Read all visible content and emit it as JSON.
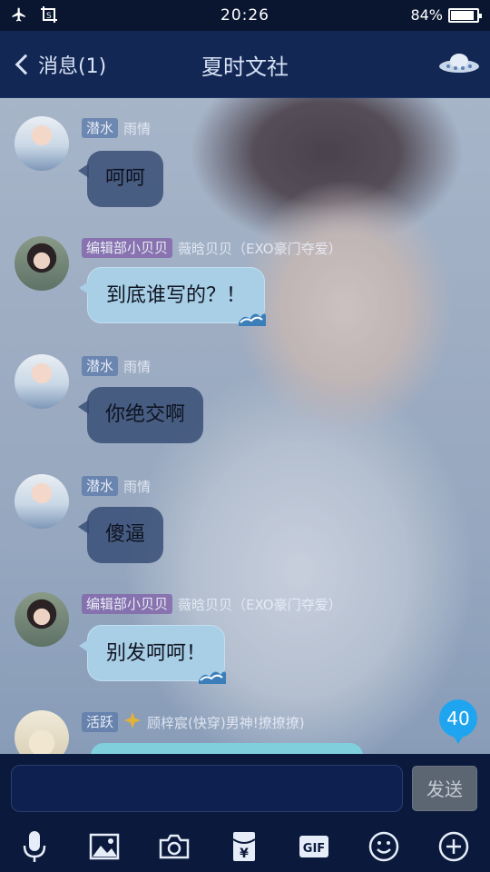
{
  "status_bar": {
    "left_icons": [
      "airplane-icon",
      "screenshot-icon"
    ],
    "time": "20:26",
    "battery_text": "84%",
    "battery_level": 0.84
  },
  "header": {
    "back_label": "消息(1)",
    "title": "夏时文社",
    "right_icon": "ufo-icon"
  },
  "messages": [
    {
      "badge": "潜水",
      "badge_color": "blue",
      "sender": "雨情",
      "text": "呵呵",
      "bubble": "dark",
      "avatar": "a1"
    },
    {
      "badge": "编辑部小贝贝",
      "badge_color": "purple",
      "sender": "薇晗贝贝（EXO豪门夺爱）",
      "text": "到底谁写的？！",
      "bubble": "light",
      "avatar": "a2"
    },
    {
      "badge": "潜水",
      "badge_color": "blue",
      "sender": "雨情",
      "text": "你绝交啊",
      "bubble": "dark",
      "avatar": "a1"
    },
    {
      "badge": "潜水",
      "badge_color": "blue",
      "sender": "雨情",
      "text": "傻逼",
      "bubble": "dark",
      "avatar": "a1"
    },
    {
      "badge": "编辑部小贝贝",
      "badge_color": "purple",
      "sender": "薇晗贝贝（EXO豪门夺爱）",
      "text": "别发呵呵！",
      "bubble": "light",
      "avatar": "a2"
    },
    {
      "badge": "活跃",
      "badge_color": "blue",
      "sender": "顾梓宸(快穿)男神!撩撩撩)",
      "text": "",
      "bubble": "partial",
      "avatar": "a3"
    }
  ],
  "unread_count": "40",
  "input": {
    "value": "",
    "send_label": "发送"
  },
  "toolbar": {
    "icons": [
      "microphone-icon",
      "image-icon",
      "camera-icon",
      "red-packet-icon",
      "gif-icon",
      "emoji-icon",
      "plus-icon"
    ],
    "gif_label": "GIF",
    "red_packet_symbol": "¥"
  },
  "colors": {
    "header_bg": "#122754",
    "input_bg": "#0b1a3c",
    "unread_badge": "#1fa5f0",
    "light_bubble": "#a9cfe6"
  }
}
